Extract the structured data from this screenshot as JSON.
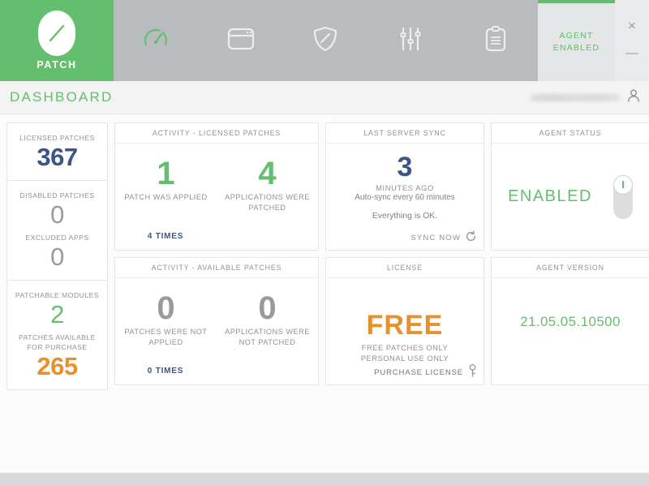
{
  "window": {
    "close_label": "×",
    "minimize_label": "—"
  },
  "brand": {
    "name": "PATCH",
    "logo_icon": "patch-slash-logo",
    "color": "#63bf6d"
  },
  "nav": {
    "items": [
      {
        "icon": "dashboard-gauge-icon",
        "active": true
      },
      {
        "icon": "window-browser-icon",
        "active": false
      },
      {
        "icon": "shield-icon",
        "active": false
      },
      {
        "icon": "sliders-settings-icon",
        "active": false
      },
      {
        "icon": "clipboard-report-icon",
        "active": false
      }
    ],
    "agent_tab": {
      "line1": "AGENT",
      "line2": "ENABLED",
      "color": "#63bf6d"
    }
  },
  "header": {
    "page_title": "DASHBOARD",
    "user_icon": "user-person-icon",
    "user_name": ""
  },
  "sidebar": {
    "groups": [
      {
        "stats": [
          {
            "label": "LICENSED PATCHES",
            "value": "367",
            "color": "#3b5584",
            "style": "navy"
          }
        ]
      },
      {
        "stats": [
          {
            "label": "DISABLED PATCHES",
            "value": "0",
            "color": "#9a9a9a",
            "style": "gray"
          },
          {
            "label": "EXCLUDED APPS",
            "value": "0",
            "color": "#9a9a9a",
            "style": "gray"
          }
        ]
      },
      {
        "stats": [
          {
            "label": "PATCHABLE MODULES",
            "value": "2",
            "color": "#63bf6d",
            "style": "green"
          },
          {
            "label": "PATCHES AVAILABLE FOR PURCHASE",
            "value": "265",
            "color": "#e8912a",
            "style": "orange"
          }
        ]
      }
    ]
  },
  "cards": {
    "activity_licensed": {
      "title": "ACTIVITY - LICENSED PATCHES",
      "left_value": "1",
      "left_caption": "PATCH WAS APPLIED",
      "right_value": "4",
      "right_caption": "APPLICATIONS WERE PATCHED",
      "times": "4 TIMES"
    },
    "last_server_sync": {
      "title": "LAST SERVER SYNC",
      "value": "3",
      "unit": "MINUTES AGO",
      "auto_sync": "Auto-sync every 60 minutes",
      "status": "Everything is OK.",
      "sync_button": "SYNC NOW",
      "sync_icon": "refresh-circle-icon"
    },
    "agent_status": {
      "title": "AGENT STATUS",
      "value": "ENABLED",
      "toggle_state": "on",
      "toggle_icon": "power-toggle-icon"
    },
    "activity_available": {
      "title": "ACTIVITY - AVAILABLE PATCHES",
      "left_value": "0",
      "left_caption": "PATCHES WERE NOT APPLIED",
      "right_value": "0",
      "right_caption": "APPLICATIONS WERE NOT PATCHED",
      "times": "0 TIMES"
    },
    "license": {
      "title": "LICENSE",
      "value": "FREE",
      "sub_line1": "FREE PATCHES ONLY",
      "sub_line2": "PERSONAL USE ONLY",
      "purchase_label": "PURCHASE LICENSE",
      "purchase_icon": "key-icon"
    },
    "agent_version": {
      "title": "AGENT VERSION",
      "value": "21.05.05.10500"
    }
  }
}
